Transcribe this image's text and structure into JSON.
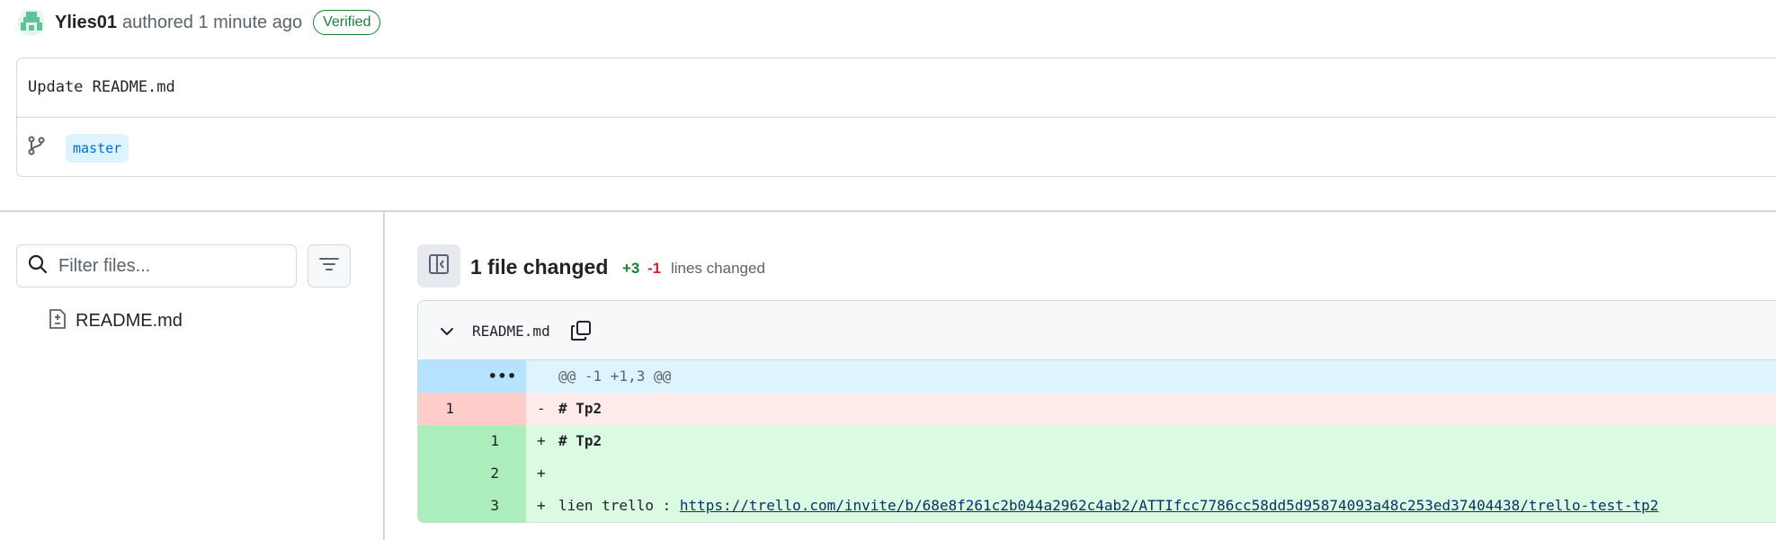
{
  "commit": {
    "author": "Ylies01",
    "authored_text": "authored 1 minute ago",
    "verified_label": "Verified",
    "message": "Update README.md",
    "branch": "master"
  },
  "file_tree": {
    "filter_placeholder": "Filter files...",
    "items": [
      {
        "label": "README.md",
        "icon": "file-diff-icon"
      }
    ]
  },
  "diff_summary": {
    "title": "1 file changed",
    "additions": "+3",
    "deletions": "-1",
    "suffix": "lines changed"
  },
  "diff_file": {
    "filename": "README.md",
    "hunk_header": "@@ -1 +1,3 @@",
    "hunk_dots": "•••",
    "lines": [
      {
        "type": "del",
        "old": "1",
        "new": "",
        "sign": "-",
        "text": "# Tp2"
      },
      {
        "type": "add",
        "old": "",
        "new": "1",
        "sign": "+",
        "text": "# Tp2"
      },
      {
        "type": "add",
        "old": "",
        "new": "2",
        "sign": "+",
        "text": ""
      },
      {
        "type": "add",
        "old": "",
        "new": "3",
        "sign": "+",
        "text_prefix": "lien trello : ",
        "link": "https://trello.com/invite/b/68e8f261c2b044a2962c4ab2/ATTIfcc7786cc58dd5d95874093a48c253ed37404438/trello-test-tp2"
      }
    ]
  },
  "colors": {
    "verified": "#1a7f37",
    "additions": "#1a7f37",
    "deletions": "#d1242f",
    "branch_pill_bg": "#ddf4ff",
    "hunk_bg": "#ddf4ff",
    "del_bg": "#ffebe9",
    "add_bg": "#dafbe1"
  }
}
